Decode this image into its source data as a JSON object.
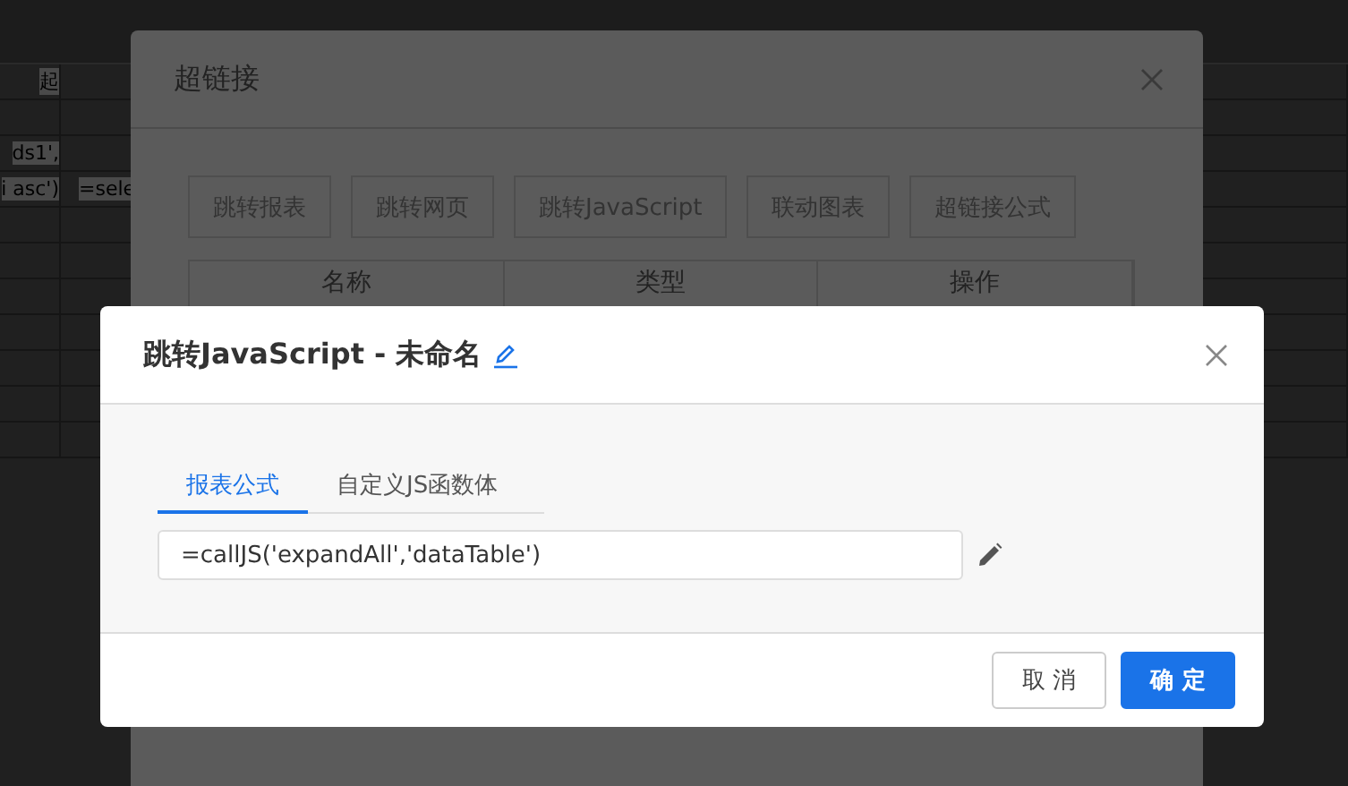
{
  "background_sheet": {
    "cells": [
      {
        "text": "起"
      },
      {
        "text": "ds1',"
      },
      {
        "text": "i asc')"
      },
      {
        "text": "=sele"
      }
    ]
  },
  "hyperlink_dialog": {
    "title": "超链接",
    "type_buttons": [
      "跳转报表",
      "跳转网页",
      "跳转JavaScript",
      "联动图表",
      "超链接公式"
    ],
    "table": {
      "columns": [
        "名称",
        "类型",
        "操作"
      ]
    }
  },
  "js_dialog": {
    "title": "跳转JavaScript - 未命名",
    "tabs": [
      {
        "label": "报表公式",
        "selected": true
      },
      {
        "label": "自定义JS函数体",
        "selected": false
      }
    ],
    "formula": {
      "value": "=callJS('expandAll','dataTable')"
    },
    "buttons": [
      {
        "label": "取 消",
        "kind": "secondary"
      },
      {
        "label": "确 定",
        "kind": "primary"
      }
    ]
  }
}
